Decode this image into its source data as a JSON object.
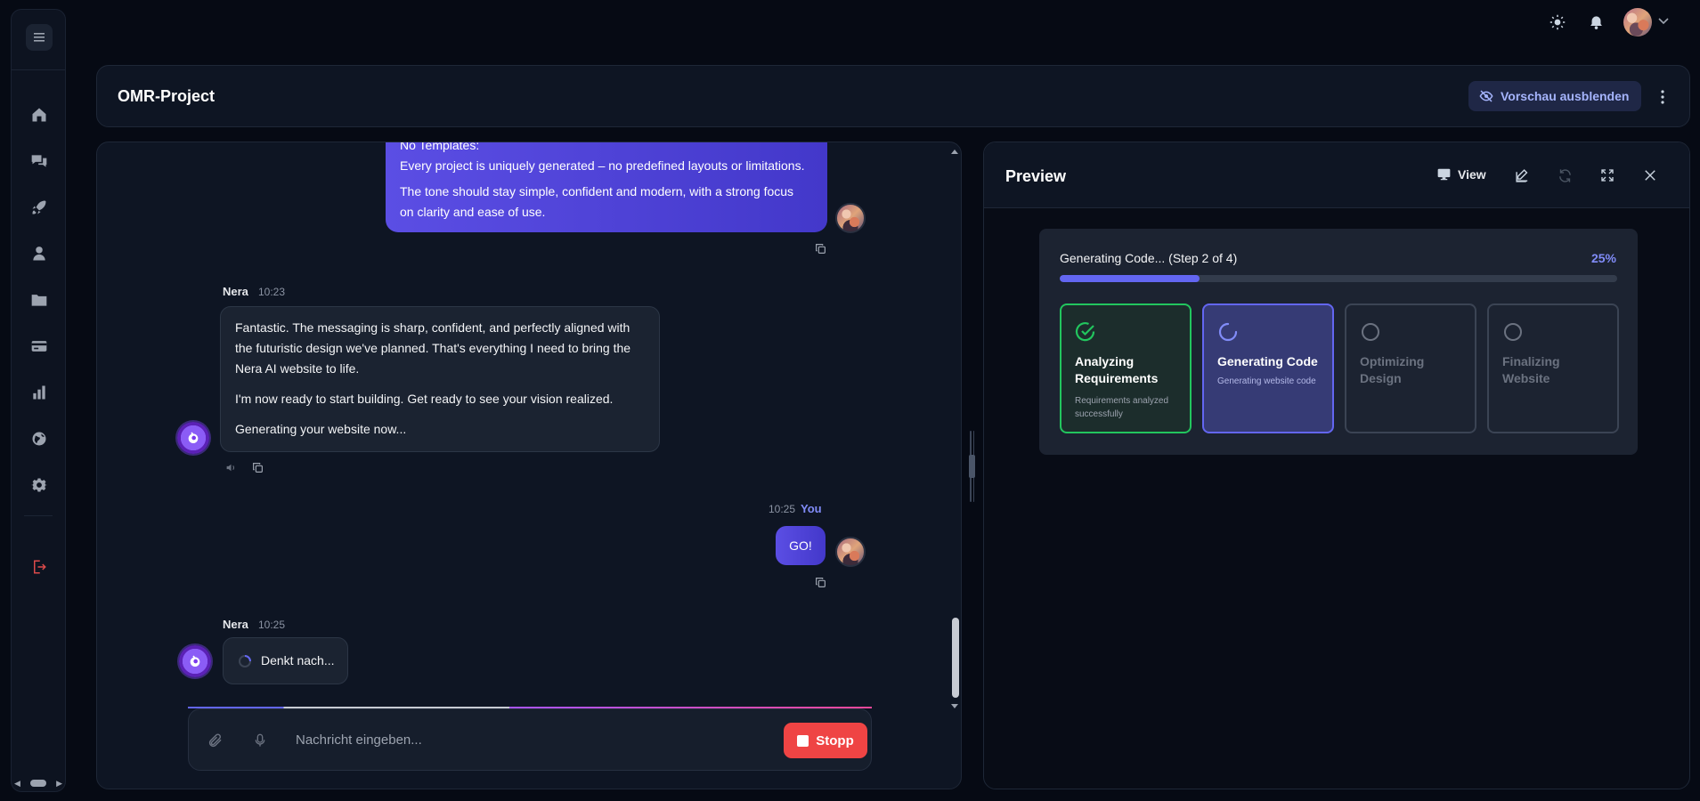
{
  "rail": {
    "toggle_icon": "menu-icon",
    "items": [
      {
        "id": "home",
        "icon": "home-icon"
      },
      {
        "id": "chats",
        "icon": "chat-bubbles-icon"
      },
      {
        "id": "launch",
        "icon": "rocket-icon"
      },
      {
        "id": "profile",
        "icon": "user-icon"
      },
      {
        "id": "files",
        "icon": "folder-icon"
      },
      {
        "id": "billing",
        "icon": "card-icon"
      },
      {
        "id": "analytics",
        "icon": "bar-chart-icon"
      },
      {
        "id": "explore",
        "icon": "globe-icon"
      },
      {
        "id": "settings",
        "icon": "gear-icon"
      }
    ],
    "logout_icon": "logout-icon"
  },
  "topbar": {
    "theme_icon": "sun-icon",
    "notifications_icon": "bell-icon",
    "avatar": "user-avatar"
  },
  "header": {
    "title": "OMR-Project",
    "hide_preview_label": "Vorschau ausblenden"
  },
  "chat": {
    "messages": [
      {
        "role": "user",
        "lines": [
          "No Templates:",
          "Every project is uniquely generated – no predefined layouts or limitations.",
          "The tone should stay simple, confident and modern, with a strong focus",
          "on clarity and ease of use."
        ]
      },
      {
        "role": "assistant",
        "name": "Nera",
        "time": "10:23",
        "paragraphs": [
          [
            "Fantastic. The messaging is sharp, confident, and perfectly aligned with",
            "the futuristic design we've planned. That's everything I need to bring the",
            "Nera AI website to life."
          ],
          [
            "I'm now ready to start building. Get ready to see your vision realized."
          ],
          [
            "Generating your website now..."
          ]
        ]
      },
      {
        "role": "user",
        "name": "You",
        "time": "10:25",
        "text": "GO!"
      },
      {
        "role": "assistant",
        "name": "Nera",
        "time": "10:25",
        "text": "Denkt nach..."
      }
    ],
    "composer": {
      "placeholder": "Nachricht eingeben...",
      "stop_label": "Stopp"
    }
  },
  "preview": {
    "title": "Preview",
    "view_label": "View",
    "progress": {
      "label": "Generating Code... (Step 2 of 4)",
      "percent_text": "25%",
      "value": 0.25
    },
    "steps": [
      {
        "name": "Analyzing Requirements",
        "status": "done",
        "desc": "Requirements analyzed successfully"
      },
      {
        "name": "Generating Code",
        "status": "active",
        "desc": "Generating website code"
      },
      {
        "name": "Optimizing Design",
        "status": "pending",
        "desc": ""
      },
      {
        "name": "Finalizing Website",
        "status": "pending",
        "desc": ""
      }
    ]
  },
  "colors": {
    "accent": "#6366f1",
    "success": "#22c55e",
    "danger": "#ef4444",
    "background": "#060a14"
  }
}
